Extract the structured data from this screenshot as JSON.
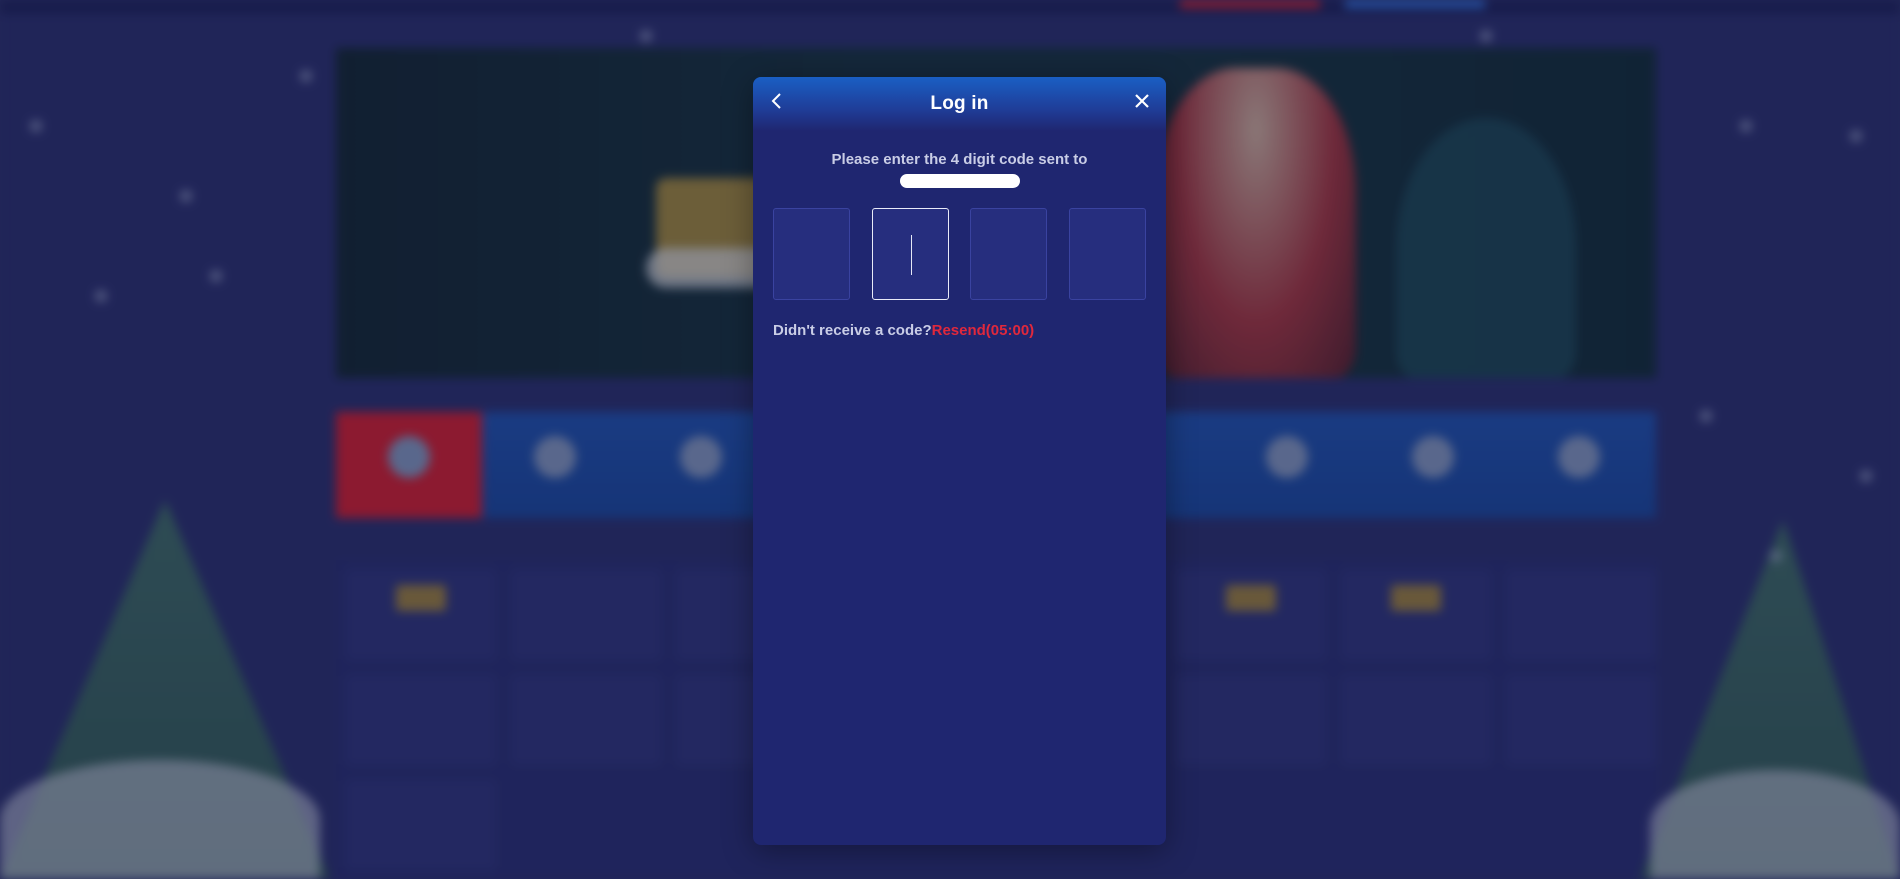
{
  "modal": {
    "title": "Log in",
    "prompt": "Please enter the 4 digit code sent to",
    "code_digits": [
      "",
      "",
      "",
      ""
    ],
    "active_index": 1,
    "resend_question": "Didn't receive a code?",
    "resend_link": "Resend(05:00)"
  },
  "icons": {
    "back": "chevron-left-icon",
    "close": "close-icon"
  },
  "colors": {
    "modal_bg": "#1f2670",
    "header_gradient_top": "#1a5fc4",
    "resend_accent": "#e0283c",
    "page_bg": "#272d68"
  }
}
